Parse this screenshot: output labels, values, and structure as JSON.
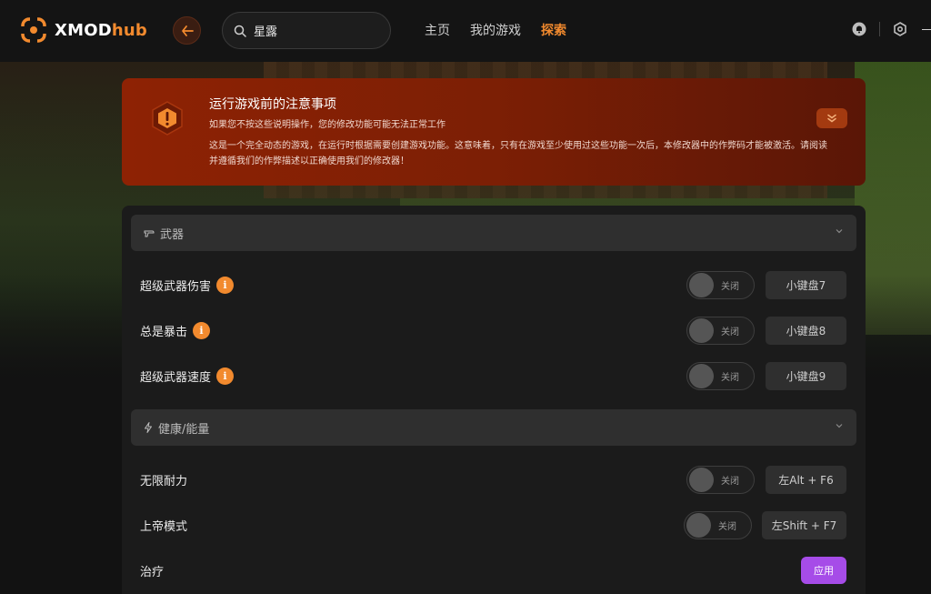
{
  "app": {
    "brand_main": "XMOD",
    "brand_accent": "hub",
    "accent_color": "#f28a2e"
  },
  "header": {
    "search_value": "星露",
    "nav": [
      {
        "label": "主页",
        "active": false
      },
      {
        "label": "我的游戏",
        "active": false
      },
      {
        "label": "探索",
        "active": true
      }
    ],
    "icons": [
      "back-arrow-icon",
      "search-icon",
      "notification-icon",
      "settings-icon"
    ]
  },
  "notice": {
    "title": "运行游戏前的注意事项",
    "subtitle": "如果您不按这些说明操作，您的修改功能可能无法正常工作",
    "body": "这是一个完全动态的游戏，在运行时根据需要创建游戏功能。这意味着，只有在游戏至少使用过这些功能一次后，本修改器中的作弊码才能被激活。请阅读并遵循我们的作弊描述以正确使用我们的修改器！",
    "icon": "warning-icon",
    "color": "#8e2204"
  },
  "sections": [
    {
      "title": "武器",
      "icon": "weapon-icon",
      "rows": [
        {
          "label": "超级武器伤害",
          "info": "i",
          "toggle": "关闭",
          "hotkey": "小键盘7"
        },
        {
          "label": "总是暴击",
          "info": "i",
          "toggle": "关闭",
          "hotkey": "小键盘8"
        },
        {
          "label": "超级武器速度",
          "info": "i",
          "toggle": "关闭",
          "hotkey": "小键盘9"
        }
      ]
    },
    {
      "title": "健康/能量",
      "icon": "lightning-icon",
      "rows": [
        {
          "label": "无限耐力",
          "toggle": "关闭",
          "hotkey": "左Alt + F6"
        },
        {
          "label": "上帝模式",
          "toggle": "关闭",
          "hotkey": "左Shift + F7"
        },
        {
          "label": "治疗",
          "button": "应用"
        }
      ]
    }
  ],
  "colors": {
    "apply_button": "#a64ce8",
    "info_badge": "#f28a2e"
  }
}
